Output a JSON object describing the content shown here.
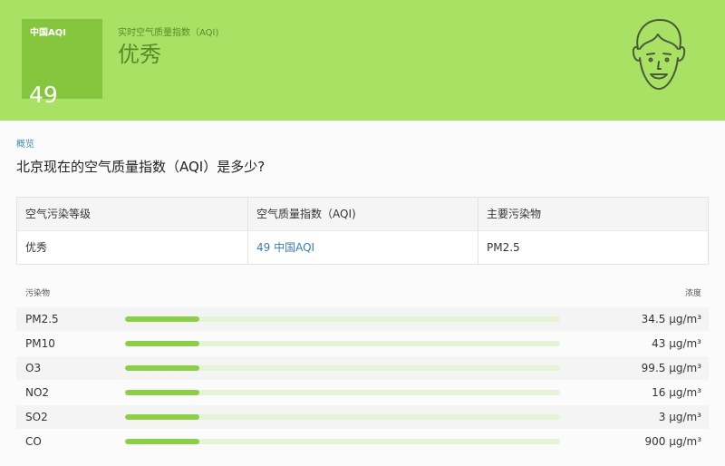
{
  "header": {
    "aqi_label": "中国AQI",
    "aqi_value": "49",
    "realtime_label": "实时空气质量指数（AQI)",
    "level": "优秀",
    "face_icon": "smiling-face-icon"
  },
  "overview": {
    "label": "概览",
    "question": "北京现在的空气质量指数（AQI）是多少?"
  },
  "summary": {
    "headers": [
      "空气污染等级",
      "空气质量指数（AQI)",
      "主要污染物"
    ],
    "values": [
      "优秀",
      "49 中国AQI",
      "PM2.5"
    ]
  },
  "pollutants": {
    "col_left": "污染物",
    "col_right": "浓度",
    "items": [
      {
        "name": "PM2.5",
        "value": "34.5 µg/m³",
        "fill": 0.17
      },
      {
        "name": "PM10",
        "value": "43 µg/m³",
        "fill": 0.17
      },
      {
        "name": "O3",
        "value": "99.5 µg/m³",
        "fill": 0.17
      },
      {
        "name": "NO2",
        "value": "16 µg/m³",
        "fill": 0.17
      },
      {
        "name": "SO2",
        "value": "3 µg/m³",
        "fill": 0.17
      },
      {
        "name": "CO",
        "value": "900 µg/m³",
        "fill": 0.17
      }
    ]
  },
  "colors": {
    "banner": "#a9e164",
    "aqi_box": "#86c53e",
    "bar_fill": "#8ccf46",
    "bar_track": "#e5f3d6",
    "link": "#3a7db0"
  }
}
